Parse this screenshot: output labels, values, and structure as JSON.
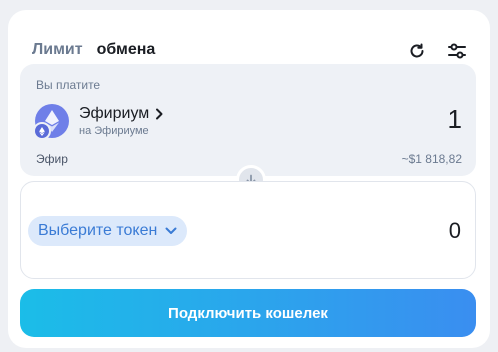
{
  "tabs": {
    "limit": "Лимит",
    "swap": "обмена"
  },
  "icons": {
    "refresh": "refresh-icon",
    "settings": "sliders-icon"
  },
  "pay": {
    "label": "Вы платите",
    "token_name": "Эфириум",
    "token_network": "на Эфириуме",
    "amount": "1",
    "symbol": "Эфир",
    "usd_value": "~$1 818,82"
  },
  "receive": {
    "select_label": "Выберите токен",
    "amount": "0"
  },
  "connect_label": "Подключить кошелек",
  "colors": {
    "accent": "#3a8ef0",
    "accent_start": "#1bbde8",
    "token_chip": "#dce9fb"
  }
}
